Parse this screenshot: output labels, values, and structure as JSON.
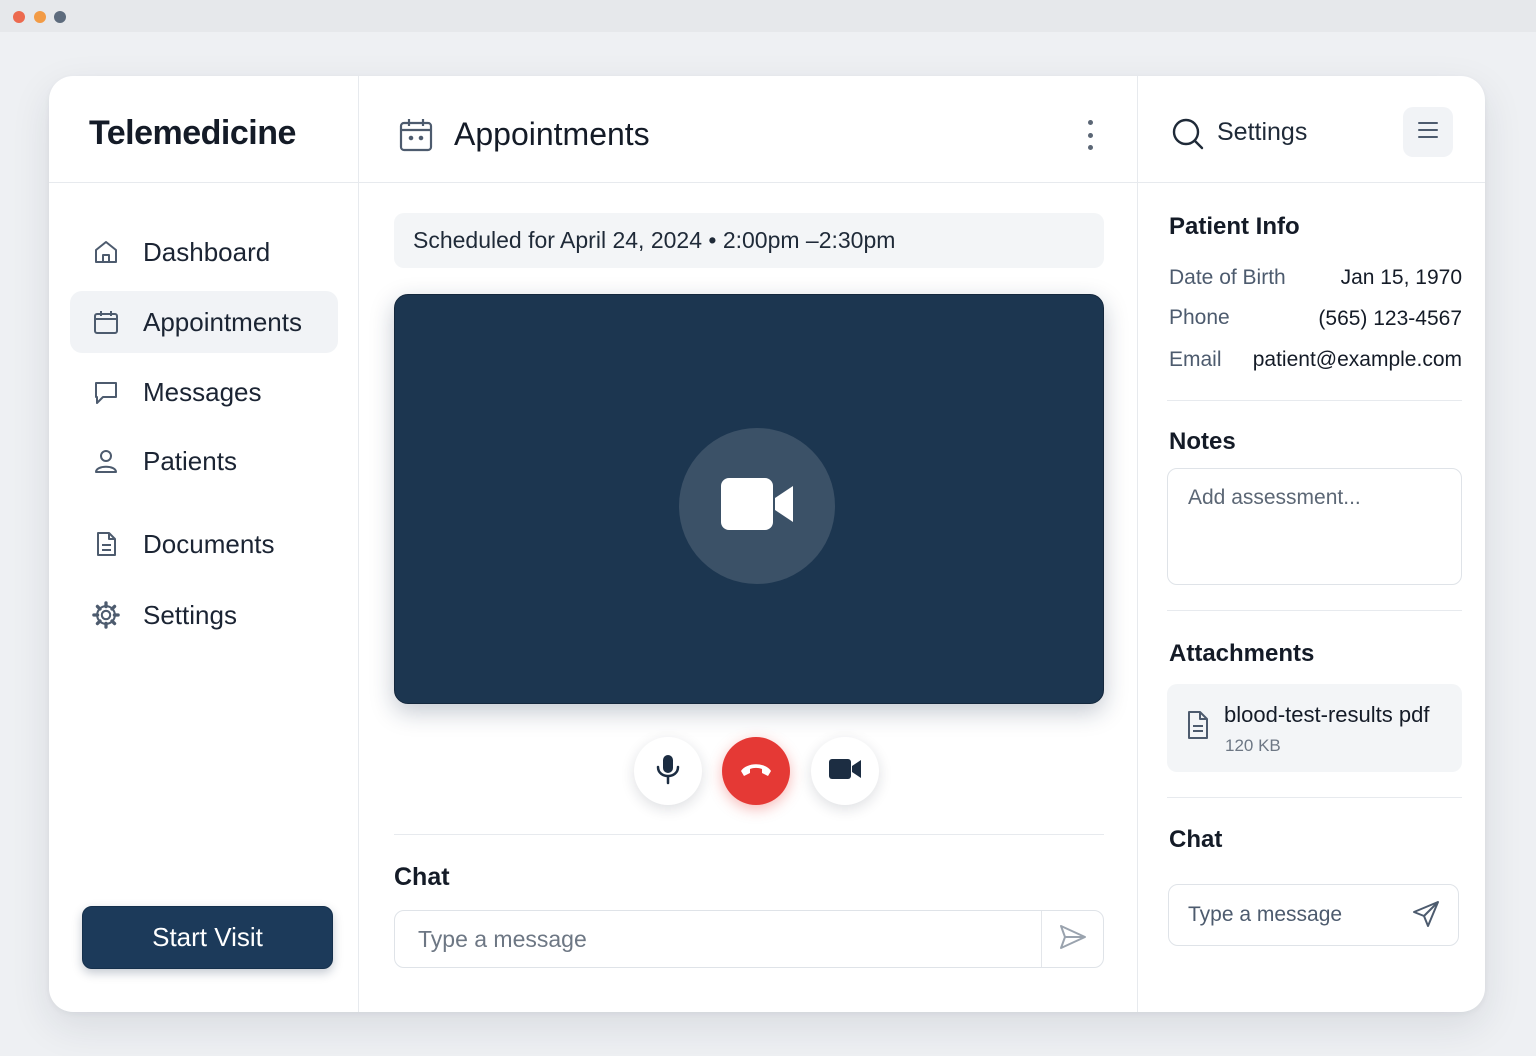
{
  "window": {
    "controls": [
      "close",
      "minimize",
      "maximize"
    ]
  },
  "sidebar": {
    "brand": "Telemedicine",
    "items": [
      {
        "label": "Dashboard",
        "icon": "home-icon",
        "active": false
      },
      {
        "label": "Appointments",
        "icon": "calendar-icon",
        "active": true
      },
      {
        "label": "Messages",
        "icon": "message-icon",
        "active": false
      },
      {
        "label": "Patients",
        "icon": "user-icon",
        "active": false
      },
      {
        "label": "Documents",
        "icon": "document-icon",
        "active": false
      },
      {
        "label": "Settings",
        "icon": "gear-icon",
        "active": false
      }
    ],
    "start_visit_label": "Start Visit"
  },
  "main": {
    "title": "Appointments",
    "schedule_text": "Scheduled for April 24, 2024 • 2:00pm –2:30pm",
    "video": {
      "placeholder_icon": "video-camera-icon"
    },
    "controls": {
      "mic_icon": "microphone-icon",
      "end_call_icon": "phone-hangup-icon",
      "camera_icon": "video-camera-icon"
    },
    "chat": {
      "title": "Chat",
      "placeholder": "Type a message"
    }
  },
  "right": {
    "settings_label": "Settings",
    "patient_info": {
      "title": "Patient Info",
      "rows": [
        {
          "label": "Date of Birth",
          "value": "Jan 15, 1970"
        },
        {
          "label": "Phone",
          "value": "(565) 123-4567"
        },
        {
          "label": "Email",
          "value": "patient@example.com"
        }
      ]
    },
    "notes": {
      "title": "Notes",
      "placeholder": "Add assessment..."
    },
    "attachments": {
      "title": "Attachments",
      "items": [
        {
          "name": "blood-test-results pdf",
          "size": "120 KB"
        }
      ]
    },
    "chat": {
      "title": "Chat",
      "placeholder": "Type a message"
    }
  },
  "colors": {
    "primary": "#1c3a5a",
    "video_bg": "#1c3650",
    "end_call": "#e53935",
    "background": "#eef0f3"
  }
}
